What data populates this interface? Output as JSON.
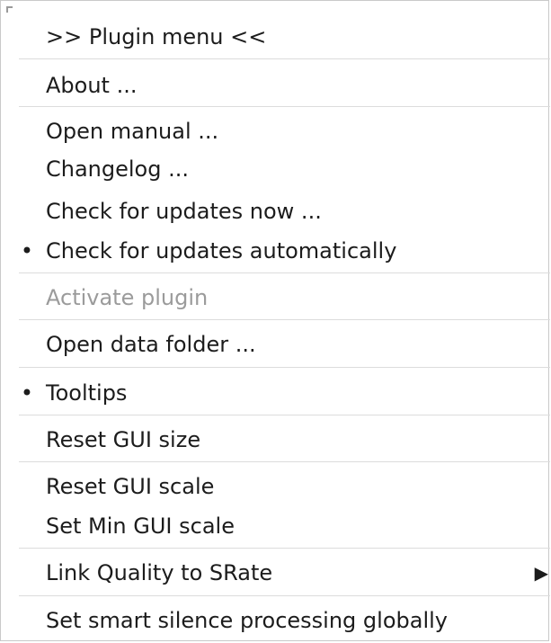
{
  "menu": {
    "header": ">> Plugin menu <<",
    "about": "About ...",
    "open_manual": "Open manual ...",
    "changelog": "Changelog ...",
    "check_updates_now": "Check for updates now ...",
    "check_updates_auto": "Check for updates automatically",
    "activate_plugin": "Activate plugin",
    "open_data_folder": "Open data folder ...",
    "tooltips": "Tooltips",
    "reset_gui_size": "Reset GUI size",
    "reset_gui_scale": "Reset GUI scale",
    "set_min_gui_scale": "Set Min GUI scale",
    "link_quality": "Link Quality to SRate",
    "set_smart_silence": "Set smart silence processing globally",
    "bullet_glyph": "•",
    "submenu_arrow_glyph": "▶"
  }
}
